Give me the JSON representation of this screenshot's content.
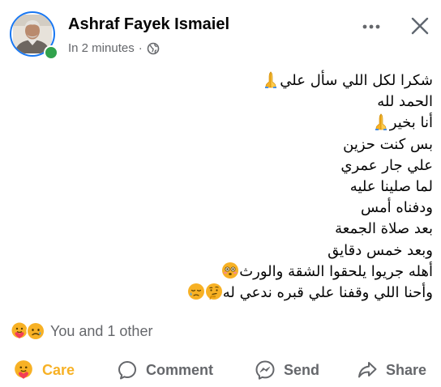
{
  "post": {
    "author": "Ashraf Fayek Ismaiel",
    "time": "In 2 minutes",
    "separator": "·",
    "privacy_icon": "globe-icon",
    "lines": [
      "شكرا لكل اللي سأل علي",
      "الحمد لله",
      "أنا بخير",
      "بس كنت حزين",
      "علي جار عمري",
      "لما صلينا عليه",
      "ودفناه أمس",
      "بعد صلاة الجمعة",
      "وبعد خمس دقايق",
      "أهله جريوا يلحقوا الشقة والورث",
      "وأحنا اللي وقفنا علي قبره ندعي له"
    ],
    "line_emojis": [
      [
        "folded-hands-emoji"
      ],
      [],
      [
        "folded-hands-emoji"
      ],
      [],
      [],
      [],
      [],
      [],
      [],
      [
        "flushed-face-emoji"
      ],
      [
        "thinking-face-emoji",
        "sad-relieved-face-emoji"
      ]
    ]
  },
  "reactions": {
    "icons": [
      "care-reaction-icon",
      "sad-reaction-icon"
    ],
    "summary": "You and 1 other"
  },
  "actions": {
    "care": "Care",
    "comment": "Comment",
    "send": "Send",
    "share": "Share"
  },
  "header_controls": {
    "more_icon": "more-horizontal-icon",
    "close_icon": "close-icon"
  },
  "colors": {
    "accent": "#1877f2",
    "online": "#31a24c",
    "care": "#f7b125",
    "secondary_text": "#65676b",
    "primary_text": "#050505"
  }
}
